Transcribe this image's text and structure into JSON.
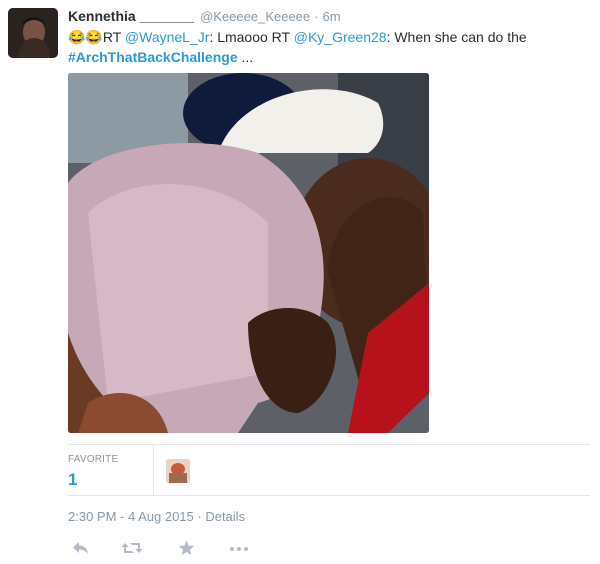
{
  "tweet": {
    "display_name": "Kennethia _______",
    "handle": "@Keeeee_Keeeee",
    "separator": "·",
    "age": "6m",
    "emoji": "😂😂",
    "text_rt1": "RT ",
    "mention1": "@WayneL_Jr",
    "text_mid": ": Lmaooo RT ",
    "mention2": "@Ky_Green28",
    "text_after": ": When she can do the",
    "hashtag": "#ArchThatBackChallenge",
    "ellipsis": " ..."
  },
  "stats": {
    "favorite_label": "FAVORITE",
    "favorite_count": "1"
  },
  "timestamp": {
    "time": "2:30 PM - 4 Aug 2015",
    "sep": " · ",
    "details": "Details"
  },
  "actions": [
    {
      "icon": "reply-icon"
    },
    {
      "icon": "retweet-icon"
    },
    {
      "icon": "favorite-icon"
    },
    {
      "icon": "more-icon"
    }
  ],
  "colors": {
    "link": "#2b9ad9",
    "muted": "#8899a6",
    "border": "#e1e8ed",
    "action": "#b3bcc5"
  }
}
